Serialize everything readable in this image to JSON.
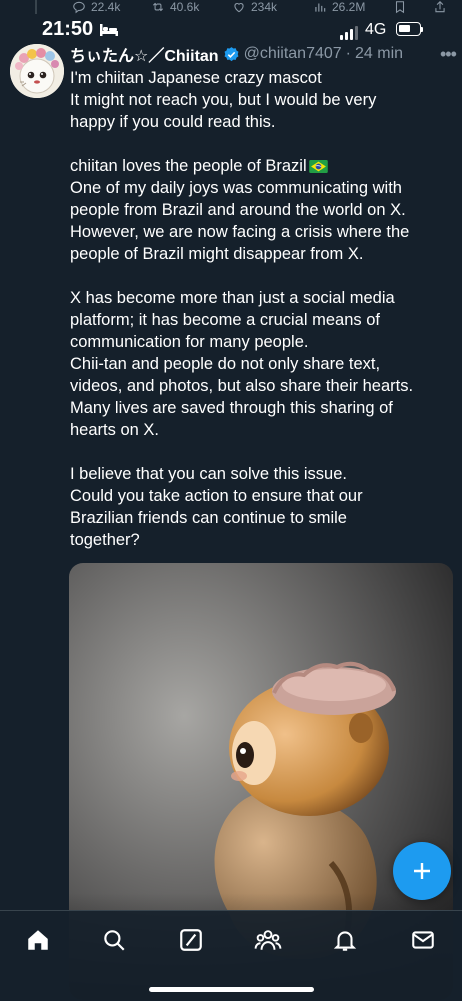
{
  "previous_tweet_metrics": {
    "replies": "22.4k",
    "reposts": "40.6k",
    "likes": "234k",
    "views": "26.2M"
  },
  "status_bar": {
    "time": "21:50",
    "network": "4G",
    "battery_level": 0.6
  },
  "tweet": {
    "display_name": "ちぃたん☆／Chiitan",
    "handle": "@chiitan7407",
    "separator": "·",
    "time_ago": "24 min",
    "verified": true,
    "lines": [
      "I'm chiitan Japanese crazy mascot",
      "It might not reach you, but I would be very",
      "happy if you could read this.",
      "",
      "chiitan loves the people of Brazil",
      "One of my daily joys was communicating with",
      "people from Brazil and around the world on X.",
      "However, we are now facing a crisis where the",
      "people of Brazil might disappear from X.",
      "",
      "X has become more than just a social media",
      "platform; it has become a crucial means of",
      "communication for many people.",
      "Chii-tan and people do not only share text,",
      "videos, and photos, but also share their hearts.",
      "Many lives are saved through this sharing of",
      "hearts on X.",
      "",
      "I believe that you can solve this issue.",
      "Could you take action to ensure that our",
      "Brazilian friends can continue to smile",
      "together?"
    ]
  },
  "icons": {
    "reply": "reply-icon",
    "repost": "repost-icon",
    "like": "heart-icon",
    "views": "views-icon",
    "bookmark": "bookmark-icon",
    "share": "share-icon",
    "more": "more-icon",
    "compose": "plus-icon",
    "nav": [
      "home-icon",
      "search-icon",
      "grok-icon",
      "communities-icon",
      "notifications-icon",
      "messages-icon"
    ]
  },
  "colors": {
    "background": "#15202b",
    "accent": "#1d9bf0",
    "text": "#e7e9ea",
    "muted": "#8b98a5"
  }
}
